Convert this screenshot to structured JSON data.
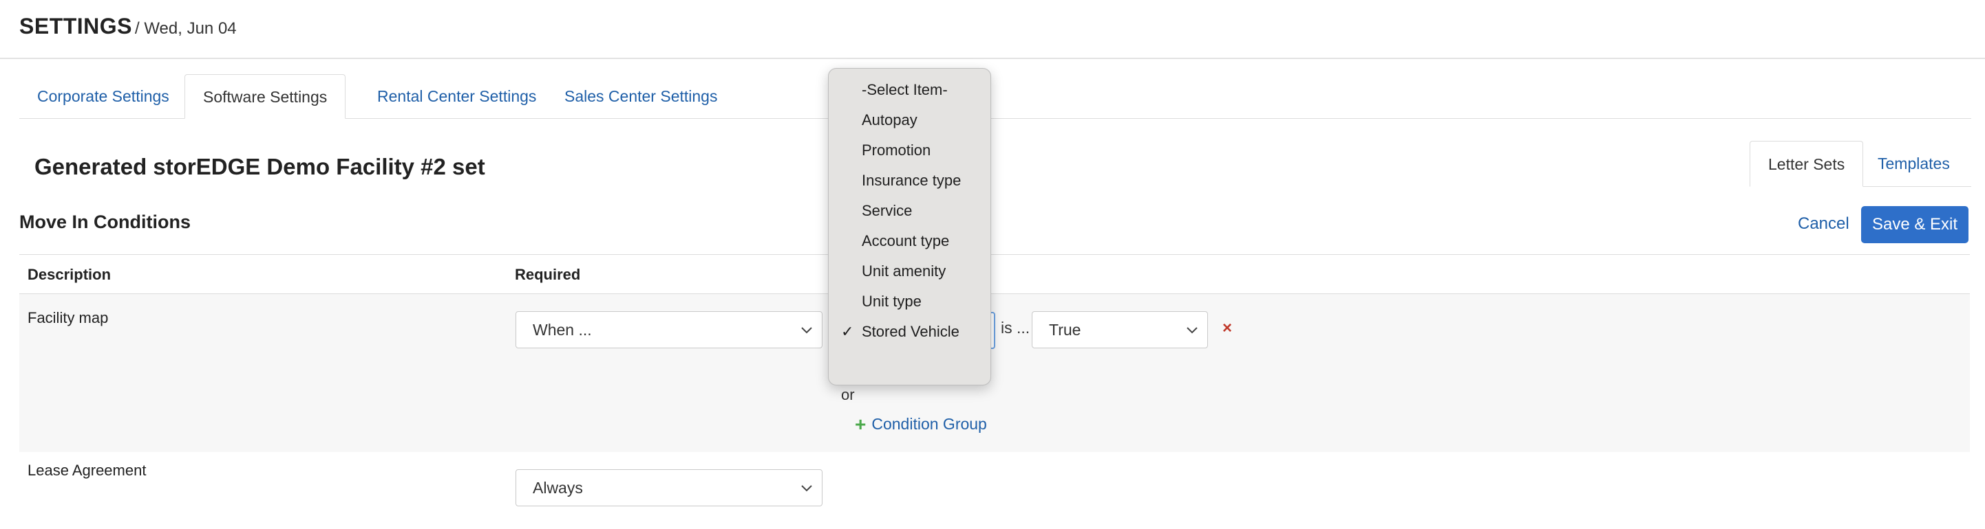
{
  "header": {
    "title": "SETTINGS",
    "date": "/ Wed, Jun 04"
  },
  "tabs": [
    {
      "label": "Corporate Settings"
    },
    {
      "label": "Software Settings"
    },
    {
      "label": "Rental Center Settings"
    },
    {
      "label": "Sales Center Settings"
    }
  ],
  "set_title": "Generated storEDGE Demo Facility #2 set",
  "right_tabs": [
    {
      "label": "Letter Sets"
    },
    {
      "label": "Templates"
    }
  ],
  "section": {
    "title": "Move In Conditions",
    "cancel_label": "Cancel",
    "save_label": "Save & Exit"
  },
  "table": {
    "headers": [
      "Description",
      "Required"
    ],
    "rows": [
      {
        "description": "Facility map",
        "required": "When ...",
        "is_label": "is ...",
        "value": "True",
        "remove": "×",
        "or_label": "or",
        "condition_group_label": "Condition Group"
      },
      {
        "description": "Lease Agreement",
        "required": "Always"
      }
    ]
  },
  "dropdown": {
    "options": [
      "-Select Item-",
      "Autopay",
      "Promotion",
      "Insurance type",
      "Service",
      "Account type",
      "Unit amenity",
      "Unit type",
      "Stored Vehicle"
    ],
    "selected": "Stored Vehicle",
    "check_glyph": "✓"
  },
  "colors": {
    "link": "#1f5fa8",
    "primary_button": "#2e6fc9",
    "remove": "#c0392b",
    "add": "#4aa84a"
  },
  "icons": [
    "chevron-down-icon",
    "check-icon",
    "close-icon",
    "plus-icon"
  ]
}
